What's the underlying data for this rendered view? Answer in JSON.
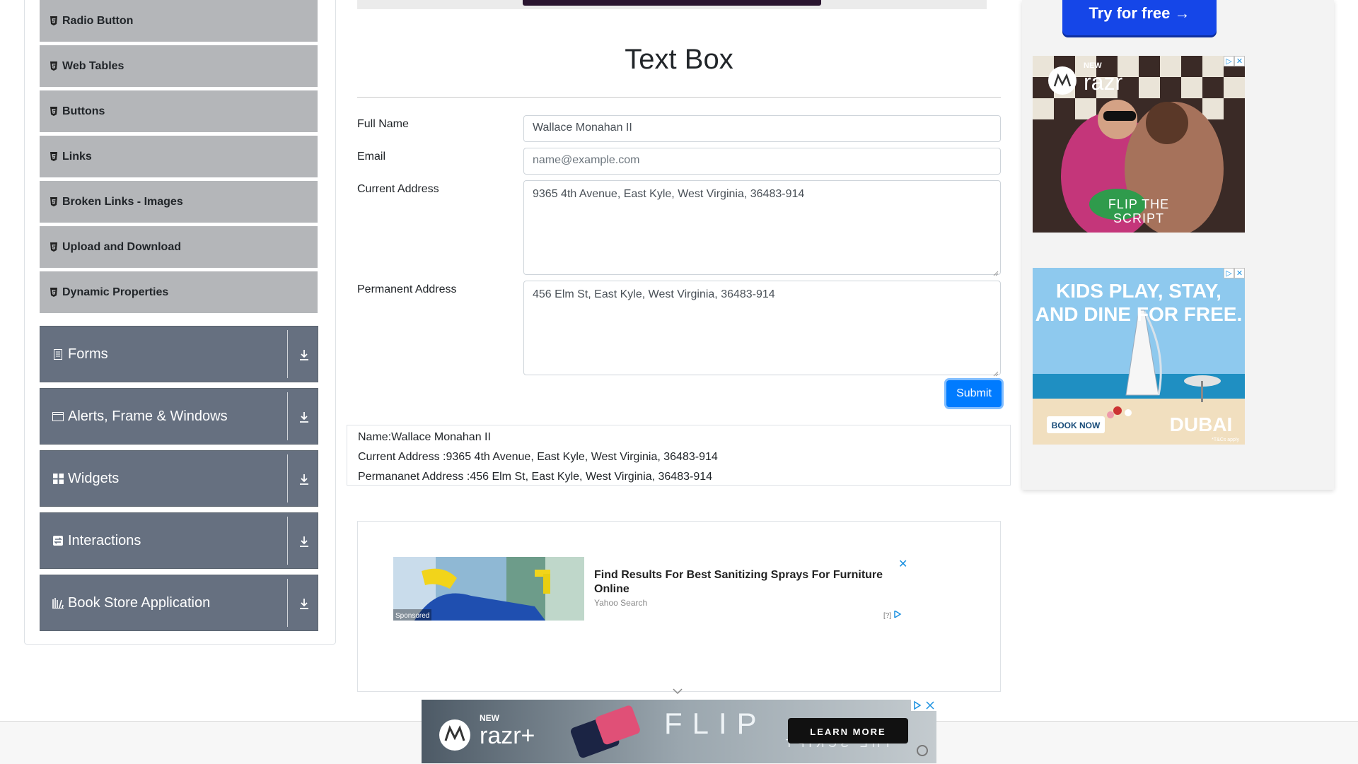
{
  "sidebar": {
    "sub_items": [
      {
        "label": "Radio Button"
      },
      {
        "label": "Web Tables"
      },
      {
        "label": "Buttons"
      },
      {
        "label": "Links"
      },
      {
        "label": "Broken Links - Images"
      },
      {
        "label": "Upload and Download"
      },
      {
        "label": "Dynamic Properties"
      }
    ],
    "groups": [
      {
        "label": "Forms",
        "icon": "form-icon"
      },
      {
        "label": "Alerts, Frame & Windows",
        "icon": "window-icon"
      },
      {
        "label": "Widgets",
        "icon": "widgets-icon"
      },
      {
        "label": "Interactions",
        "icon": "interactions-icon"
      },
      {
        "label": "Book Store Application",
        "icon": "book-store-icon"
      }
    ]
  },
  "main": {
    "title": "Text Box",
    "form": {
      "full_name_label": "Full Name",
      "full_name_value": "Wallace Monahan II",
      "email_label": "Email",
      "email_placeholder": "name@example.com",
      "current_address_label": "Current Address",
      "current_address_value": "9365 4th Avenue, East Kyle, West Virginia, 36483-914",
      "permanent_address_label": "Permanent Address",
      "permanent_address_value": "456 Elm St, East Kyle, West Virginia, 36483-914",
      "submit_label": "Submit"
    },
    "output": {
      "name": "Name:Wallace Monahan II",
      "current_address": "Current Address :9365 4th Avenue, East Kyle, West Virginia, 36483-914",
      "permanent_address": "Permananet Address :456 Elm St, East Kyle, West Virginia, 36483-914"
    },
    "ad": {
      "title": "Find Results For Best Sanitizing Sprays For Furniture Online",
      "source": "Yahoo Search",
      "sponsored": "Sponsored",
      "close": "✕",
      "info": "[?]"
    }
  },
  "right": {
    "try_button": "Try for free →",
    "razr_ad": {
      "new": "NEW",
      "brand": "razr",
      "tagline_1": "FLIP THE",
      "tagline_2": "SCRIPT"
    },
    "dubai_ad": {
      "line1": "KIDS PLAY, STAY,",
      "line2": "AND DINE FOR FREE.",
      "cta": "BOOK NOW",
      "brand": "DUBAI",
      "terms": "*T&Cs apply"
    }
  },
  "bottom_ad": {
    "new": "NEW",
    "brand": "razr+",
    "flip": "FLIP",
    "script": "THE SCRIPT",
    "cta": "LEARN MORE"
  },
  "colors": {
    "accent": "#007bff",
    "sidebar_group": "#667080",
    "sidebar_sub": "#b4b6b9"
  }
}
